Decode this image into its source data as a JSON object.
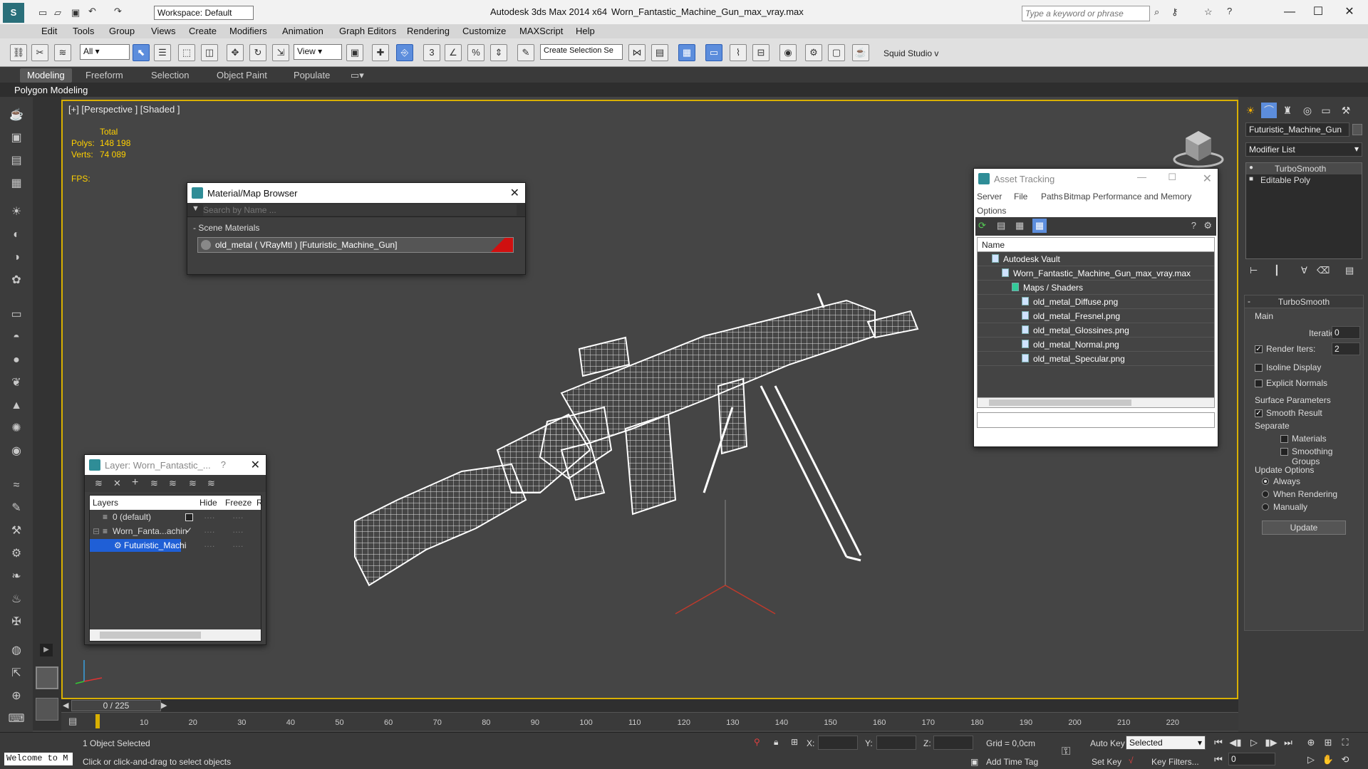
{
  "app": {
    "title": "Autodesk 3ds Max  2014 x64",
    "file": "Worn_Fantastic_Machine_Gun_max_vray.max",
    "search_placeholder": "Type a keyword or phrase",
    "workspace": "Workspace: Default"
  },
  "menu": [
    "Edit",
    "Tools",
    "Group",
    "Views",
    "Create",
    "Modifiers",
    "Animation",
    "Graph Editors",
    "Rendering",
    "Customize",
    "MAXScript",
    "Help"
  ],
  "toolbar": {
    "filter": "All",
    "ref_coord": "View",
    "selection_set": "Create Selection Se",
    "squid": "Squid Studio v"
  },
  "ribbon": {
    "tabs": [
      "Modeling",
      "Freeform",
      "Selection",
      "Object Paint",
      "Populate"
    ],
    "sub": "Polygon Modeling"
  },
  "viewport": {
    "label": "[+] [Perspective ] [Shaded ]",
    "stats": {
      "total": "Total",
      "polys_label": "Polys:",
      "polys": "148 198",
      "verts_label": "Verts:",
      "verts": "74 089",
      "fps": "FPS:"
    }
  },
  "material_browser": {
    "title": "Material/Map Browser",
    "search_placeholder": "Search by Name ...",
    "group": "- Scene Materials",
    "item": "old_metal  ( VRayMtl ) [Futuristic_Machine_Gun]"
  },
  "asset_tracking": {
    "title": "Asset Tracking",
    "menu": [
      "Server",
      "File",
      "Paths",
      "Bitmap Performance and Memory",
      "Options"
    ],
    "column": "Name",
    "items": [
      {
        "label": "Autodesk Vault",
        "indent": 1
      },
      {
        "label": "Worn_Fantastic_Machine_Gun_max_vray.max",
        "indent": 2
      },
      {
        "label": "Maps / Shaders",
        "indent": 3
      },
      {
        "label": "old_metal_Diffuse.png",
        "indent": 4
      },
      {
        "label": "old_metal_Fresnel.png",
        "indent": 4
      },
      {
        "label": "old_metal_Glossines.png",
        "indent": 4
      },
      {
        "label": "old_metal_Normal.png",
        "indent": 4
      },
      {
        "label": "old_metal_Specular.png",
        "indent": 4
      }
    ]
  },
  "layer_window": {
    "title": "Layer: Worn_Fantastic_...",
    "help": "?",
    "columns": {
      "layers": "Layers",
      "hide": "Hide",
      "freeze": "Freeze",
      "r": "R"
    },
    "rows": [
      {
        "label": "0 (default)"
      },
      {
        "label": "Worn_Fanta...achin"
      },
      {
        "label": "Futuristic_Machi"
      }
    ]
  },
  "command_panel": {
    "object_name": "Futuristic_Machine_Gun",
    "modifier_list": "Modifier List",
    "stack": [
      "TurboSmooth",
      "Editable Poly"
    ],
    "rollout": "TurboSmooth",
    "main": "Main",
    "iterations_label": "Iterations:",
    "iterations": "0",
    "render_iters_label": "Render Iters:",
    "render_iters": "2",
    "isoline": "Isoline Display",
    "explicit": "Explicit Normals",
    "surface": "Surface Parameters",
    "smooth_result": "Smooth Result",
    "separate": "Separate",
    "materials": "Materials",
    "smoothing_groups": "Smoothing Groups",
    "update_options": "Update Options",
    "always": "Always",
    "when_rendering": "When Rendering",
    "manually": "Manually",
    "update": "Update"
  },
  "timeline": {
    "frame": "0 / 225",
    "ticks": [
      "10",
      "20",
      "30",
      "40",
      "50",
      "60",
      "70",
      "80",
      "90",
      "100",
      "110",
      "120",
      "130",
      "140",
      "150",
      "160",
      "170",
      "180",
      "190",
      "200",
      "210",
      "220"
    ]
  },
  "status": {
    "welcome": "Welcome to M",
    "selected": "1 Object Selected",
    "prompt": "Click or click-and-drag to select objects",
    "x": "X:",
    "y": "Y:",
    "z": "Z:",
    "grid": "Grid = 0,0cm",
    "auto_key": "Auto Key",
    "key_mode": "Selected",
    "set_key": "Set Key",
    "key_filters": "Key Filters...",
    "add_time_tag": "Add Time Tag",
    "frame_field": "0"
  }
}
